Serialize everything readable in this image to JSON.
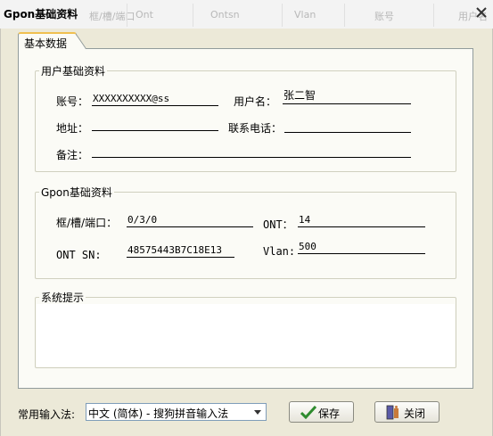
{
  "window": {
    "title": "Gpon基础资料",
    "ghost_headers": [
      "框/槽/端口",
      "Ont",
      "Ontsn",
      "Vlan",
      "账号",
      "用户名"
    ],
    "close_icon": "close-icon"
  },
  "tab": {
    "label": "基本数据"
  },
  "user_group": {
    "legend": "用户基础资料",
    "account_label": "账号：",
    "account_value": "XXXXXXXXXX@ss",
    "username_label": "用户名：",
    "username_value": "张二智",
    "address_label": "地址：",
    "address_value": "",
    "phone_label": "联系电话：",
    "phone_value": "",
    "note_label": "备注：",
    "note_value": ""
  },
  "gpon_group": {
    "legend": "Gpon基础资料",
    "port_label": "框/槽/端口：",
    "port_value": "0/3/0",
    "ont_label": "ONT：",
    "ont_value": "14",
    "ontsn_label": "ONT SN:",
    "ontsn_value": "48575443B7C18E13",
    "vlan_label": "Vlan:",
    "vlan_value": "500"
  },
  "system_group": {
    "legend": "系统提示",
    "message": ""
  },
  "bottom": {
    "ime_label": "常用输入法:",
    "ime_value": "中文 (简体) - 搜狗拼音输入法",
    "save_label": "保存",
    "close_label": "关闭",
    "save_icon": "check-icon",
    "close_icon": "exit-door-icon"
  },
  "colors": {
    "save_check": "#2e8b2e",
    "tab_highlight": "#f0c050"
  }
}
